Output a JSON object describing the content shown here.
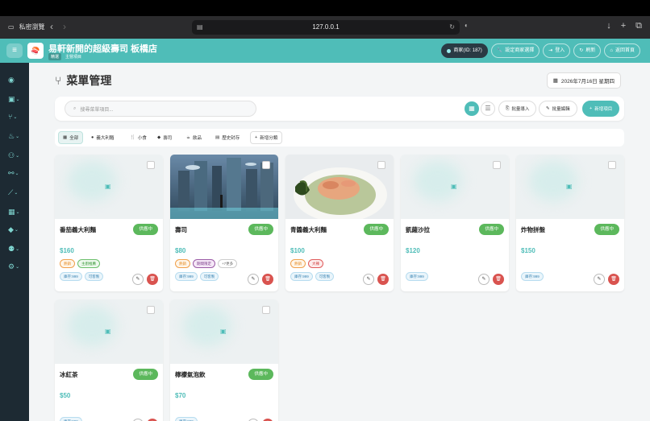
{
  "browser": {
    "private_label": "私密瀏覽",
    "url": "127.0.0.1"
  },
  "header": {
    "logo_text": "🍣",
    "store_name": "易軒新開的超級壽司 板橋店",
    "badges": [
      "精選",
      "主營項目"
    ],
    "merchant_label": "商家(ID: 187)",
    "set_merchant_label": "設定商家選擇",
    "login_label": "登入",
    "refresh_label": "刷新",
    "home_label": "返回首頁"
  },
  "page": {
    "title": "菜單管理",
    "date": "2026年7月16日 星期四"
  },
  "toolbar": {
    "search_placeholder": "搜尋菜單項目...",
    "batch_import": "批量導入",
    "batch_edit": "批量編輯",
    "add_item": "新增項目"
  },
  "categories": [
    {
      "label": "全部",
      "icon": "▦"
    },
    {
      "label": "義大利麵",
      "icon": "●"
    },
    {
      "label": "小食",
      "icon": "🍴"
    },
    {
      "label": "壽司",
      "icon": "◆"
    },
    {
      "label": "飲品",
      "icon": "☕"
    },
    {
      "label": "歷史封存",
      "icon": "▤"
    },
    {
      "label": "新增分類",
      "icon": "+"
    }
  ],
  "items": [
    {
      "name": "番茄義大利麵",
      "status": "供應中",
      "price": "$160",
      "tags": [
        {
          "label": "熱銷",
          "style": "orange"
        },
        {
          "label": "主廚推薦",
          "style": "green"
        }
      ],
      "stock": [
        "庫存:999",
        "可客製"
      ],
      "image": "blank"
    },
    {
      "name": "壽司",
      "status": "供應中",
      "price": "$80",
      "tags": [
        {
          "label": "熱銷",
          "style": "orange"
        },
        {
          "label": "期間限定",
          "style": "purple"
        },
        {
          "label": "+7更多",
          "style": "grey"
        }
      ],
      "stock": [
        "庫存:999",
        "可客製"
      ],
      "image": "city"
    },
    {
      "name": "青醬義大利麵",
      "status": "供應中",
      "price": "$100",
      "tags": [
        {
          "label": "熱銷",
          "style": "orange"
        },
        {
          "label": "大辣",
          "style": "red"
        }
      ],
      "stock": [
        "庫存:999",
        "可客製"
      ],
      "image": "pasta"
    },
    {
      "name": "凱薩沙拉",
      "status": "供應中",
      "price": "$120",
      "tags": [],
      "stock": [
        "庫存:999"
      ],
      "image": "blank"
    },
    {
      "name": "炸物拼盤",
      "status": "供應中",
      "price": "$150",
      "tags": [],
      "stock": [
        "庫存:999"
      ],
      "image": "blank"
    },
    {
      "name": "冰紅茶",
      "status": "供應中",
      "price": "$50",
      "tags": [],
      "stock": [
        "庫存:999"
      ],
      "image": "blank"
    },
    {
      "name": "檸檬氣泡飲",
      "status": "供應中",
      "price": "$70",
      "tags": [],
      "stock": [
        "庫存:999"
      ],
      "image": "blank"
    }
  ],
  "colors": {
    "accent": "#4fbdb8",
    "sidebar": "#1d2a33",
    "status": "#5cb85c",
    "danger": "#d9534f"
  }
}
